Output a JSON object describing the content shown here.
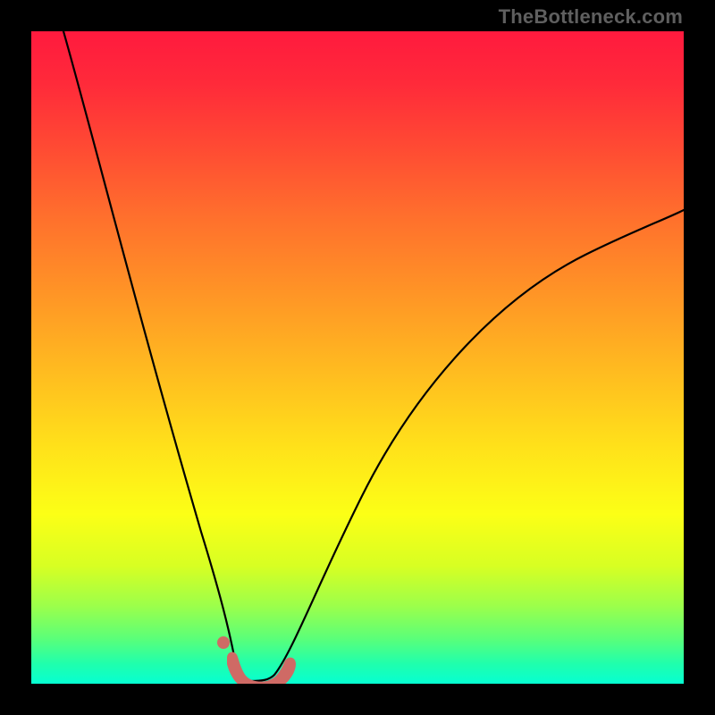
{
  "attribution": "TheBottleneck.com",
  "colors": {
    "background": "#000000",
    "gradient_top": "#ff1a3e",
    "gradient_bottom": "#06ffd2",
    "curve": "#000000",
    "marker": "#cf6a65"
  },
  "chart_data": {
    "type": "line",
    "title": "",
    "xlabel": "",
    "ylabel": "",
    "xlim": [
      0,
      100
    ],
    "ylim": [
      0,
      100
    ],
    "grid": false,
    "legend": false,
    "series": [
      {
        "name": "left_branch",
        "x": [
          5,
          8,
          11,
          14,
          17,
          20,
          23,
          25.5,
          28,
          29.5,
          30.5,
          31.5
        ],
        "y": [
          100,
          88,
          76,
          64,
          52,
          40,
          28,
          18.5,
          9,
          4.5,
          2,
          0.5
        ]
      },
      {
        "name": "right_branch",
        "x": [
          37,
          38,
          40,
          43,
          47,
          52,
          58,
          65,
          73,
          82,
          91,
          100
        ],
        "y": [
          0.5,
          2.5,
          7,
          14,
          23,
          32,
          41,
          49.5,
          57,
          63.5,
          68.5,
          72.5
        ]
      },
      {
        "name": "valley_floor",
        "x": [
          31.5,
          33,
          34.5,
          36,
          37
        ],
        "y": [
          0.5,
          0.2,
          0.2,
          0.3,
          0.5
        ]
      }
    ],
    "annotations": [
      {
        "name": "bottom_marker",
        "shape": "rounded_segment",
        "color": "#cf6a65",
        "x_range": [
          29.5,
          38.5
        ],
        "y": 1
      },
      {
        "name": "dot_marker",
        "shape": "dot",
        "color": "#cf6a65",
        "x": 29,
        "y": 6
      }
    ]
  }
}
